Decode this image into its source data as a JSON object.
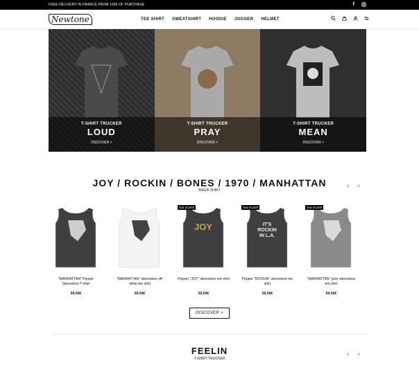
{
  "topbar": {
    "message": "FREE DELIVERY IN FRANCE FROM 100€ OF PURCHASE",
    "facebook_icon": "facebook-icon",
    "instagram_icon": "instagram-icon"
  },
  "header": {
    "logo": "Newtone",
    "nav": [
      "TEE SHIRT",
      "SWEATSHIRT",
      "HOODIE",
      "JOGGER",
      "HELMET"
    ],
    "icons": [
      "search-icon",
      "bag-icon",
      "user-icon",
      "filter-icon"
    ]
  },
  "hero": [
    {
      "kicker": "T-SHIRT TRUCKER",
      "title": "LOUD",
      "link": "DISCOVER >",
      "shirt_color": "#4a4a4a"
    },
    {
      "kicker": "T-SHIRT TRUCKER",
      "title": "PRAY",
      "link": "DISCOVER >",
      "shirt_color": "#a9a9a9"
    },
    {
      "kicker": "T-SHIRT TRUCKER",
      "title": "MEAN",
      "link": "DISCOVER >",
      "shirt_color": "#bdbdbd"
    }
  ],
  "section1": {
    "title": "JOY / ROCKIN / BONES / 1970 / MANHATTAN",
    "subtitle": "BIKER SHIRT",
    "discover": "DISCOVER >"
  },
  "products": [
    {
      "name": "\"MANHATTAN\" Pepper Sleeveless T-shirt",
      "price": "69.00€",
      "badge": "",
      "tank_color": "#3f3f42",
      "print_text": ""
    },
    {
      "name": "\"MANHATTAN\" sleeveless off-white tee shirt",
      "price": "69.00€",
      "badge": "",
      "tank_color": "#f4f4f4",
      "print_text": ""
    },
    {
      "name": "Pepper \"JOY\" sleeveless tee shirt",
      "price": "69.00€",
      "badge": "Out of print",
      "tank_color": "#3f3f42",
      "print_text": "JOY"
    },
    {
      "name": "Pepper \"ROCKIN\" sleeveless tee shirt",
      "price": "69.00€",
      "badge": "Out of print",
      "tank_color": "#3f3f42",
      "print_text": "IT'S ROCKIN IN L.A."
    },
    {
      "name": "\"MANHATTAN\" gray sleeveless tee shirt",
      "price": "69.00€",
      "badge": "Out of print",
      "tank_color": "#8a8a8a",
      "print_text": ""
    }
  ],
  "section2": {
    "title": "FEELIN",
    "subtitle": "T-SHIRT TRUCKER"
  },
  "arrows": {
    "prev": "‹",
    "next": "›"
  }
}
